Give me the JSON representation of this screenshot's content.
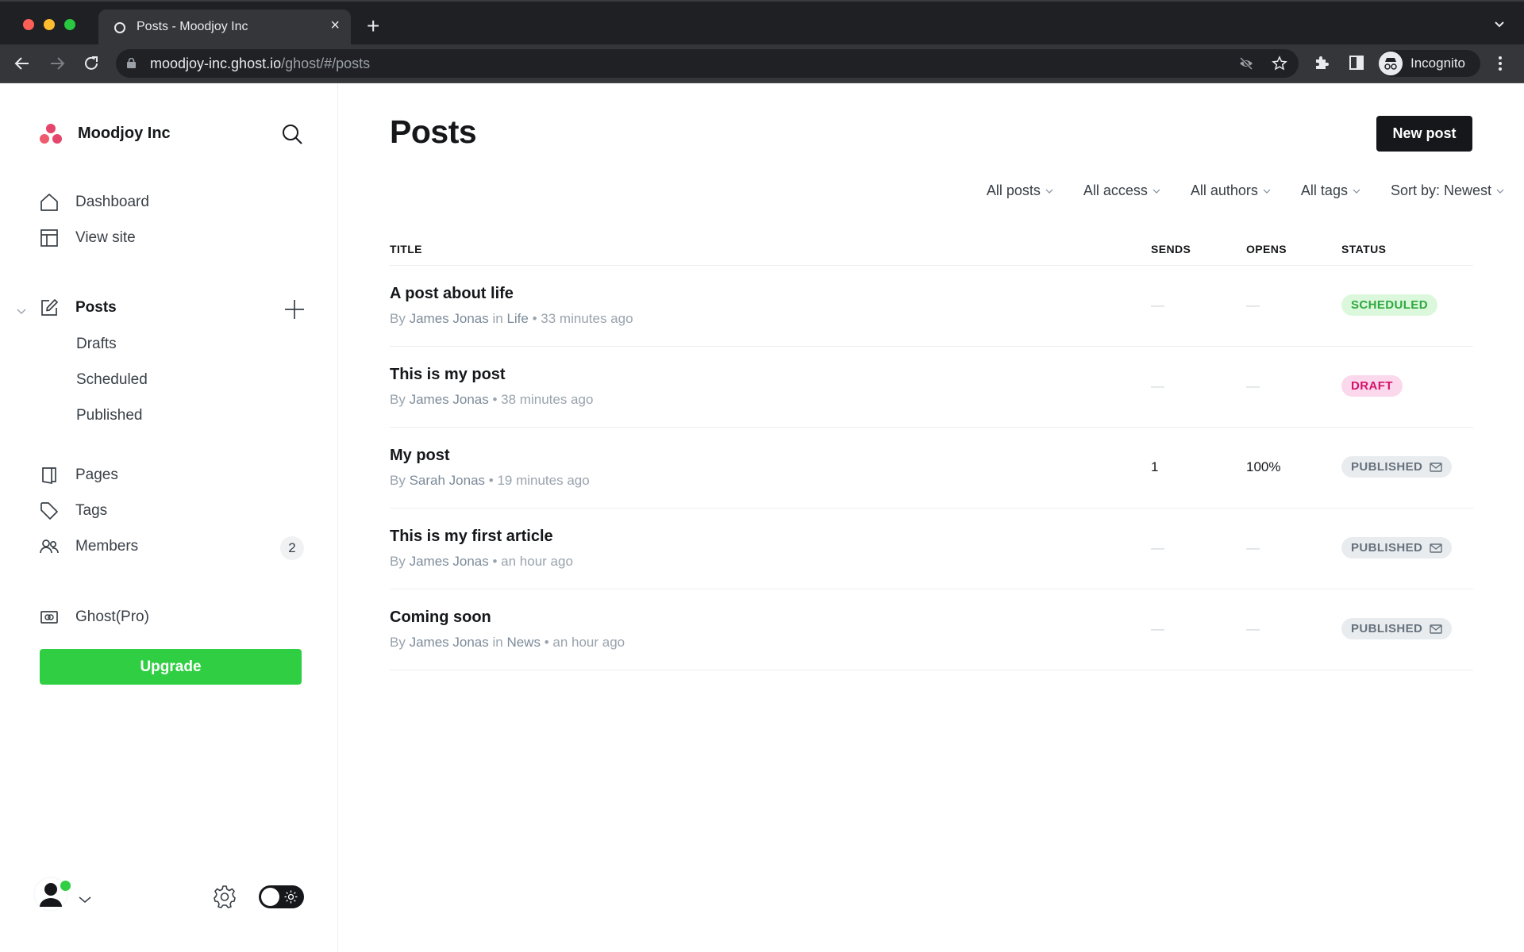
{
  "browser": {
    "tab_title": "Posts - Moodjoy Inc",
    "url_host": "moodjoy-inc.ghost.io",
    "url_path": "/ghost/#/posts",
    "profile_label": "Incognito"
  },
  "sidebar": {
    "brand_name": "Moodjoy Inc",
    "brand_color": "#e5466b",
    "nav": [
      {
        "label": "Dashboard",
        "icon": "home-icon"
      },
      {
        "label": "View site",
        "icon": "layout-icon"
      }
    ],
    "posts": {
      "label": "Posts",
      "icon": "edit-icon",
      "subitems": [
        "Drafts",
        "Scheduled",
        "Published"
      ]
    },
    "nav2": [
      {
        "label": "Pages",
        "icon": "pages-icon"
      },
      {
        "label": "Tags",
        "icon": "tag-icon"
      },
      {
        "label": "Members",
        "icon": "members-icon",
        "count": "2"
      }
    ],
    "ghost_pro": "Ghost(Pro)",
    "upgrade_label": "Upgrade",
    "upgrade_color": "#30cf43"
  },
  "main": {
    "title": "Posts",
    "new_post_label": "New post",
    "filters": [
      "All posts",
      "All access",
      "All authors",
      "All tags",
      "Sort by: Newest"
    ],
    "columns": {
      "title": "TITLE",
      "sends": "SENDS",
      "opens": "OPENS",
      "status": "STATUS"
    },
    "posts": [
      {
        "title": "A post about life",
        "by": "By",
        "author": "James Jonas",
        "in": "in",
        "tag": "Life",
        "sep": "•",
        "time": "33 minutes ago",
        "sends": "—",
        "opens": "—",
        "status": "SCHEDULED",
        "status_type": "scheduled",
        "emailed": false
      },
      {
        "title": "This is my post",
        "by": "By",
        "author": "James Jonas",
        "in": "",
        "tag": "",
        "sep": "•",
        "time": "38 minutes ago",
        "sends": "—",
        "opens": "—",
        "status": "DRAFT",
        "status_type": "draft",
        "emailed": false
      },
      {
        "title": "My post",
        "by": "By",
        "author": "Sarah Jonas",
        "in": "",
        "tag": "",
        "sep": "•",
        "time": "19 minutes ago",
        "sends": "1",
        "opens": "100%",
        "status": "PUBLISHED",
        "status_type": "published",
        "emailed": true
      },
      {
        "title": "This is my first article",
        "by": "By",
        "author": "James Jonas",
        "in": "",
        "tag": "",
        "sep": "•",
        "time": "an hour ago",
        "sends": "—",
        "opens": "—",
        "status": "PUBLISHED",
        "status_type": "published",
        "emailed": true
      },
      {
        "title": "Coming soon",
        "by": "By",
        "author": "James Jonas",
        "in": "in",
        "tag": "News",
        "sep": "•",
        "time": "an hour ago",
        "sends": "—",
        "opens": "—",
        "status": "PUBLISHED",
        "status_type": "published",
        "emailed": true
      }
    ],
    "status_colors": {
      "scheduled": {
        "bg": "#dcf8dc",
        "fg": "#2fa83f"
      },
      "draft": {
        "bg": "#fbd8eb",
        "fg": "#d3136b"
      },
      "published": {
        "bg": "#e9ecef",
        "fg": "#66717c"
      }
    }
  }
}
